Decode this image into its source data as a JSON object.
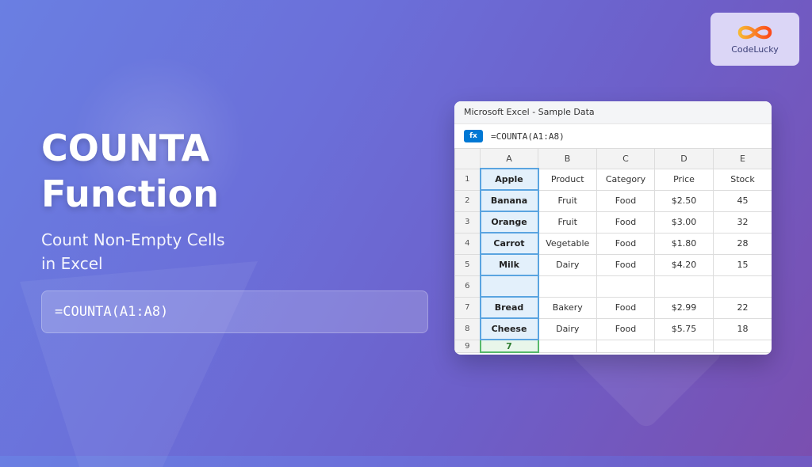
{
  "hero": {
    "title_line1": "COUNTA",
    "title_line2": "Function",
    "subtitle_line1": "Count Non-Empty Cells",
    "subtitle_line2": "in Excel",
    "formula": "=COUNTA(A1:A8)"
  },
  "logo": {
    "text": "CodeLucky"
  },
  "window": {
    "title": "Microsoft Excel - Sample Data",
    "fx_label": "fx",
    "formula": "=COUNTA(A1:A8)"
  },
  "spreadsheet": {
    "columns": [
      "A",
      "B",
      "C",
      "D",
      "E"
    ],
    "rows": [
      {
        "num": "1",
        "cells": [
          "Apple",
          "Product",
          "Category",
          "Price",
          "Stock"
        ]
      },
      {
        "num": "2",
        "cells": [
          "Banana",
          "Fruit",
          "Food",
          "$2.50",
          "45"
        ]
      },
      {
        "num": "3",
        "cells": [
          "Orange",
          "Fruit",
          "Food",
          "$3.00",
          "32"
        ]
      },
      {
        "num": "4",
        "cells": [
          "Carrot",
          "Vegetable",
          "Food",
          "$1.80",
          "28"
        ]
      },
      {
        "num": "5",
        "cells": [
          "Milk",
          "Dairy",
          "Food",
          "$4.20",
          "15"
        ]
      },
      {
        "num": "6",
        "cells": [
          "",
          "",
          "",
          "",
          ""
        ]
      },
      {
        "num": "7",
        "cells": [
          "Bread",
          "Bakery",
          "Food",
          "$2.99",
          "22"
        ]
      },
      {
        "num": "8",
        "cells": [
          "Cheese",
          "Dairy",
          "Food",
          "$5.75",
          "18"
        ]
      },
      {
        "num": "9",
        "cells": [
          "7",
          "",
          "",
          "",
          ""
        ]
      }
    ]
  },
  "colors": {
    "excel_blue": "#0078d4",
    "selection_blue": "#5aa4e0",
    "result_green": "#58b96b"
  }
}
